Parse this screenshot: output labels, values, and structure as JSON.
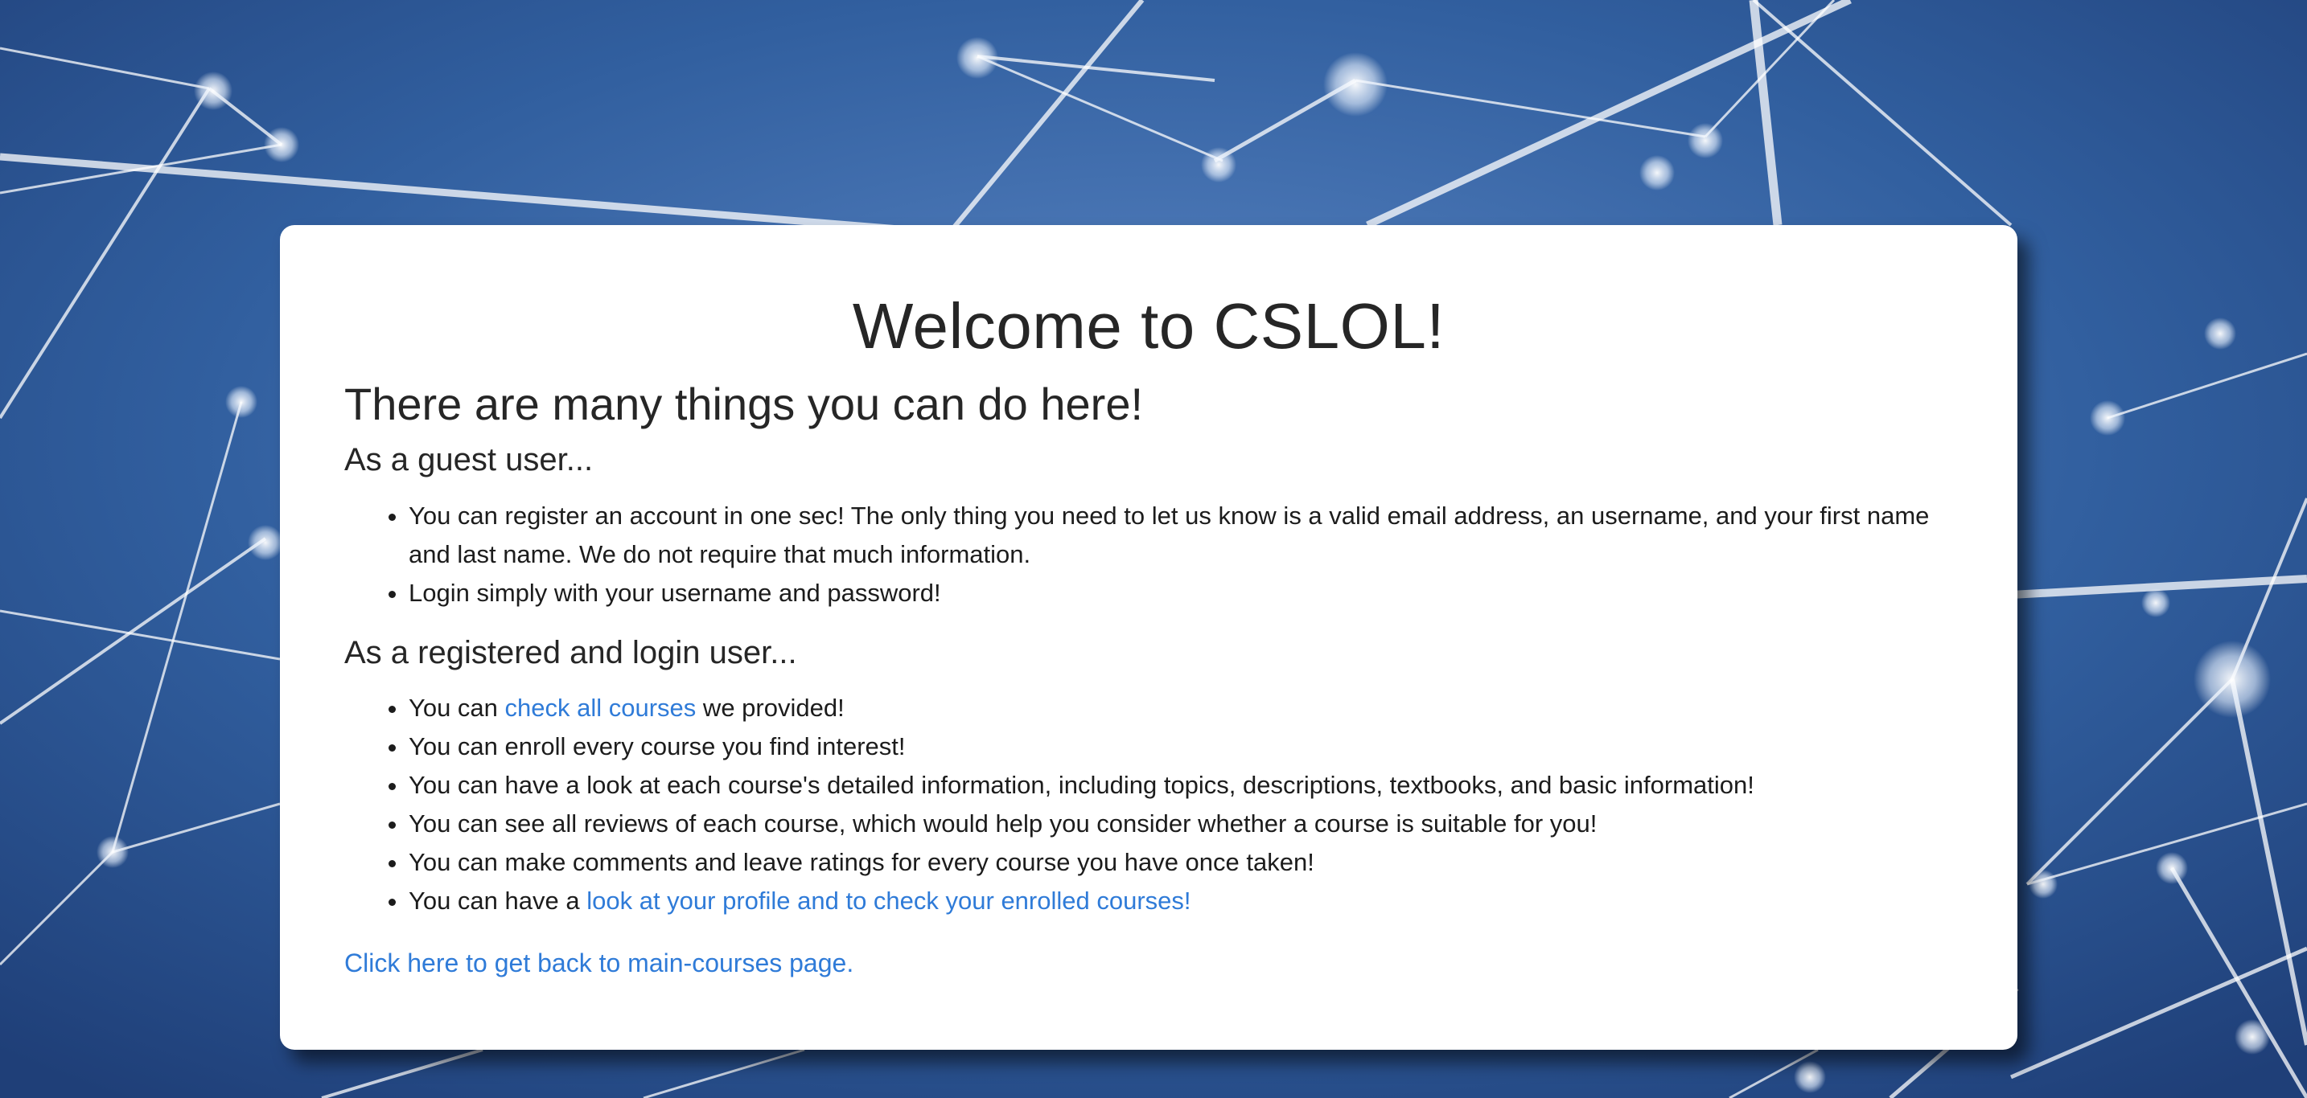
{
  "page": {
    "title": "Welcome to CSLOL!",
    "subtitle": "There are many things you can do here!",
    "guest_heading": "As a guest user...",
    "guest_items": [
      "You can register an account in one sec! The only thing you need to let us know is a valid email address, an username, and your first name and last name. We do not require that much information.",
      "Login simply with your username and password!"
    ],
    "registered_heading": "As a registered and login user...",
    "registered_items": {
      "item1_prefix": "You can ",
      "item1_link": "check all courses",
      "item1_suffix": " we provided!",
      "item2": "You can enroll every course you find interest!",
      "item3": "You can have a look at each course's detailed information, including topics, descriptions, textbooks, and basic information!",
      "item4": "You can see all reviews of each course, which would help you consider whether a course is suitable for you!",
      "item5": "You can make comments and leave ratings for every course you have once taken!",
      "item6_prefix": "You can have a ",
      "item6_link": "look at your profile and to check your enrolled courses!"
    },
    "back_link": "Click here to get back to main-courses page."
  },
  "colors": {
    "link": "#2f7bd8",
    "background_blue": "#2f5ca0",
    "card": "#ffffff"
  }
}
